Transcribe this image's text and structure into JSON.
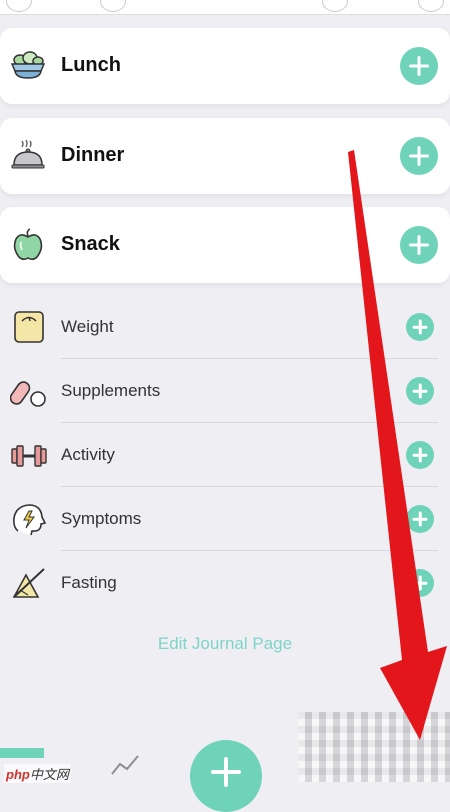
{
  "meals": [
    {
      "label": "Lunch",
      "icon": "salad-bowl-icon",
      "add_label": "+"
    },
    {
      "label": "Dinner",
      "icon": "cloche-icon",
      "add_label": "+"
    },
    {
      "label": "Snack",
      "icon": "apple-icon",
      "add_label": "+"
    }
  ],
  "trackers": [
    {
      "label": "Weight",
      "icon": "scale-icon"
    },
    {
      "label": "Supplements",
      "icon": "pill-icon"
    },
    {
      "label": "Activity",
      "icon": "dumbbell-icon"
    },
    {
      "label": "Symptoms",
      "icon": "head-bolt-icon"
    },
    {
      "label": "Fasting",
      "icon": "fasting-icon"
    }
  ],
  "edit_link": "Edit Journal Page",
  "watermark": {
    "php": "php",
    "site": "中文网"
  },
  "colors": {
    "accent": "#6ed3b8",
    "link": "#7fd4c8",
    "arrow": "#e3161b",
    "background": "#eeeef3"
  }
}
